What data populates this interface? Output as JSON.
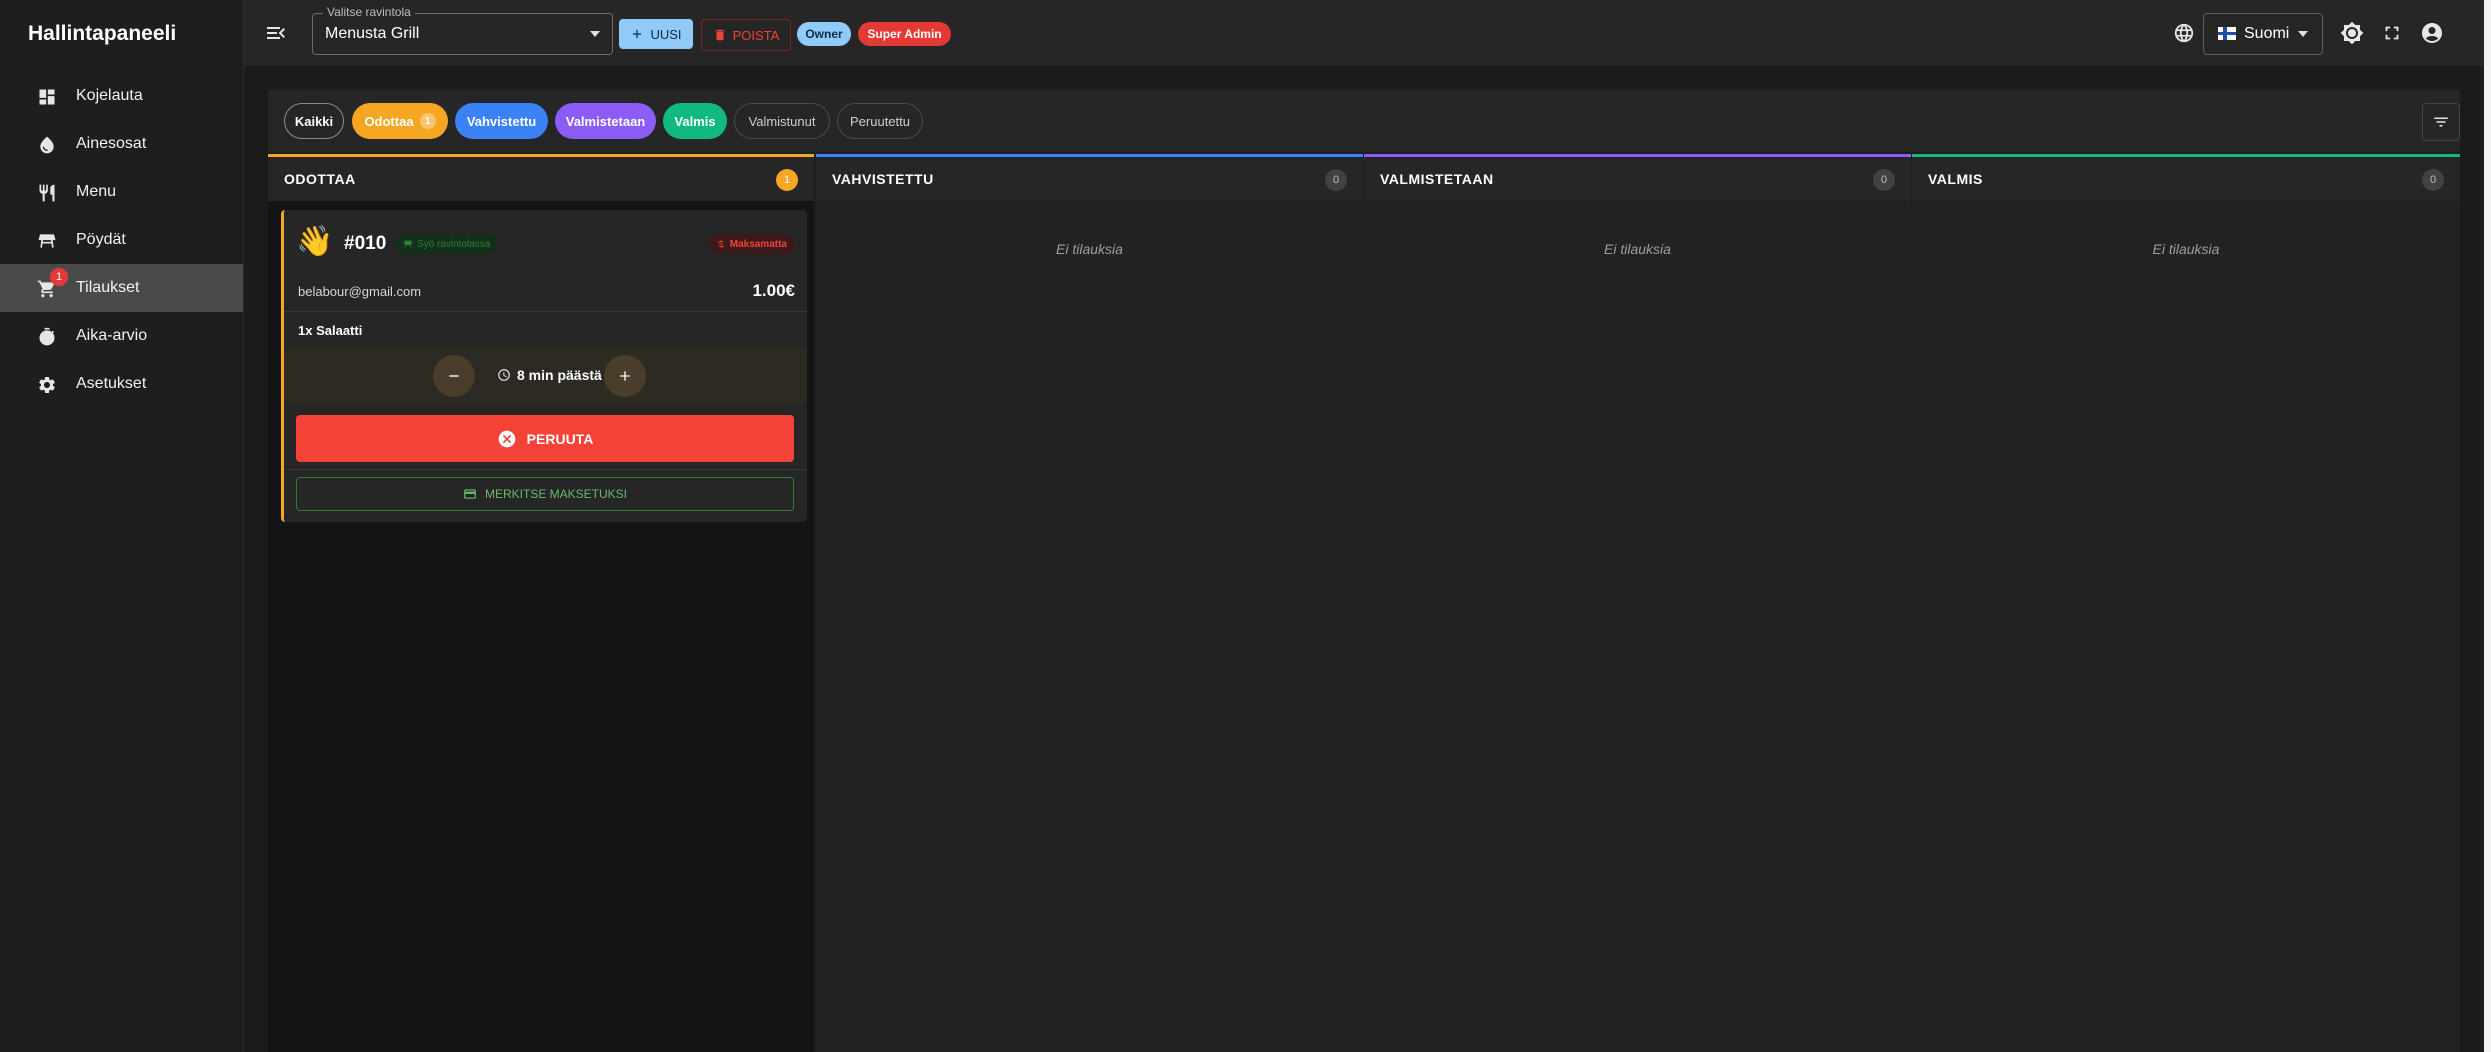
{
  "sidebar": {
    "title": "Hallintapaneeli",
    "items": [
      {
        "label": "Kojelauta",
        "icon": "dashboard-icon"
      },
      {
        "label": "Ainesosat",
        "icon": "water-drop-icon"
      },
      {
        "label": "Menu",
        "icon": "restaurant-icon"
      },
      {
        "label": "Pöydät",
        "icon": "table-icon"
      },
      {
        "label": "Tilaukset",
        "icon": "cart-icon",
        "badge": "1",
        "active": true
      },
      {
        "label": "Aika-arvio",
        "icon": "timer-icon"
      },
      {
        "label": "Asetukset",
        "icon": "gear-icon"
      }
    ]
  },
  "topbar": {
    "restaurant_select": {
      "legend": "Valitse ravintola",
      "value": "Menusta Grill"
    },
    "new_label": "UUSI",
    "delete_label": "POISTA",
    "roles": [
      "Owner",
      "Super Admin"
    ],
    "language": "Suomi"
  },
  "filters": [
    {
      "label": "Kaikki",
      "color": "#262626"
    },
    {
      "label": "Odottaa",
      "count": "1",
      "color": "#f5a623"
    },
    {
      "label": "Vahvistettu",
      "color": "#3b82f6"
    },
    {
      "label": "Valmistetaan",
      "color": "#8b5cf6"
    },
    {
      "label": "Valmis",
      "color": "#10b981"
    },
    {
      "label": "Valmistunut",
      "color": "#262626"
    },
    {
      "label": "Peruutettu",
      "color": "#262626"
    }
  ],
  "columns": [
    {
      "title": "ODOTTAA",
      "count": "1",
      "color": "#f5a623"
    },
    {
      "title": "VAHVISTETTU",
      "count": "0",
      "color": "#3b82f6",
      "empty": "Ei tilauksia"
    },
    {
      "title": "VALMISTETAAN",
      "count": "0",
      "color": "#8b5cf6",
      "empty": "Ei tilauksia"
    },
    {
      "title": "VALMIS",
      "count": "0",
      "color": "#10b981",
      "empty": "Ei tilauksia"
    }
  ],
  "order": {
    "emoji": "👋",
    "number": "#010",
    "type": "Syö ravintolassa",
    "payment_status": "Maksamatta",
    "email": "belabour@gmail.com",
    "price": "1.00€",
    "items": "1x Salaatti",
    "time": "8 min päästä",
    "cancel_label": "PERUUTA",
    "mark_paid_label": "MERKITSE MAKSETUKSI"
  }
}
